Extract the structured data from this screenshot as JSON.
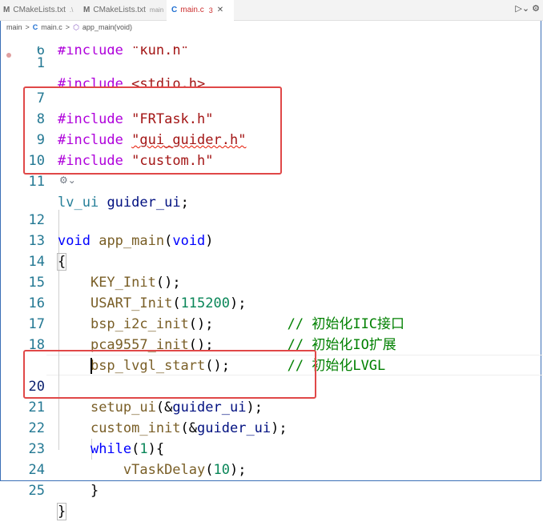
{
  "tabs": [
    {
      "icon": "M",
      "label": "CMakeLists.txt",
      "detail": ".\\",
      "active": false
    },
    {
      "icon": "M",
      "label": "CMakeLists.txt",
      "detail": "main",
      "active": false
    },
    {
      "icon": "C",
      "label": "main.c",
      "detail": "3",
      "active": true
    }
  ],
  "breadcrumb": {
    "folder": "main",
    "sep": ">",
    "file_icon": "C",
    "file": "main.c",
    "symbol": "app_main(void)"
  },
  "codelens_icon": "refactor-icon",
  "lines": [
    {
      "num": "1",
      "code": "#include <stdio.h>"
    },
    {
      "num": "6",
      "code": "#include \"kun.h\""
    },
    {
      "num": "7",
      "code": "#include \"FRTask.h\""
    },
    {
      "num": "8",
      "code": "#include \"gui_guider.h\""
    },
    {
      "num": "9",
      "code": "#include \"custom.h\""
    },
    {
      "num": "10",
      "code": ""
    },
    {
      "num": "11",
      "code": "lv_ui guider_ui;"
    },
    {
      "num": "12",
      "code": "void app_main(void)"
    },
    {
      "num": "13",
      "code": "{"
    },
    {
      "num": "14",
      "code": "    KEY_Init();"
    },
    {
      "num": "15",
      "code": "    USART_Init(115200);"
    },
    {
      "num": "16",
      "code": "    bsp_i2c_init();         // 初始化IIC接口"
    },
    {
      "num": "17",
      "code": "    pca9557_init();         // 初始化IO扩展"
    },
    {
      "num": "18",
      "code": "    bsp_lvgl_start();       // 初始化LVGL"
    },
    {
      "num": "19",
      "code": ""
    },
    {
      "num": "20",
      "code": "    setup_ui(&guider_ui);"
    },
    {
      "num": "21",
      "code": "    custom_init(&guider_ui);"
    },
    {
      "num": "22",
      "code": "    while(1){"
    },
    {
      "num": "23",
      "code": "        vTaskDelay(10);"
    },
    {
      "num": "24",
      "code": "    }"
    },
    {
      "num": "25",
      "code": "}"
    }
  ],
  "colors": {
    "highlight_box": "#e04848",
    "line_number": "#237893",
    "keyword": "#0000ff",
    "preprocessor": "#af00db",
    "string": "#a31515",
    "comment": "#008000"
  }
}
